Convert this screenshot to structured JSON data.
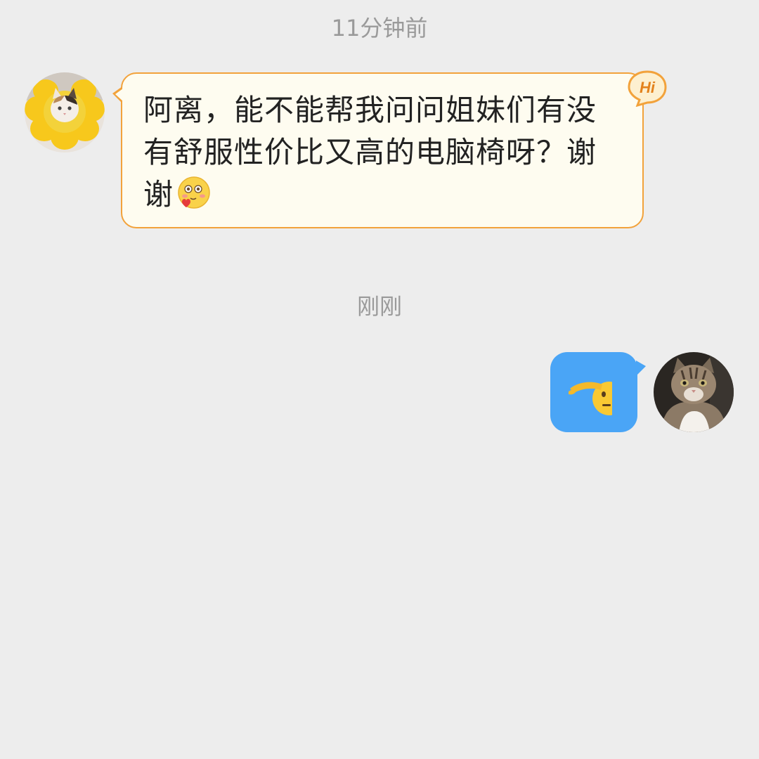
{
  "chat": {
    "timestamp_1": "11分钟前",
    "timestamp_2": "刚刚",
    "incoming": {
      "text": "阿离，能不能帮我问问姐妹们有没有舒服性价比又高的电脑椅呀？谢谢",
      "emoji": "blush-heart-emoji",
      "badge": "Hi"
    },
    "outgoing": {
      "emoji": "salute-emoji"
    }
  },
  "colors": {
    "background": "#ededed",
    "incoming_bubble": "#fefcf0",
    "incoming_border": "#f2a23b",
    "outgoing_bubble": "#4aa5f6",
    "timestamp": "#9a9a9a"
  }
}
